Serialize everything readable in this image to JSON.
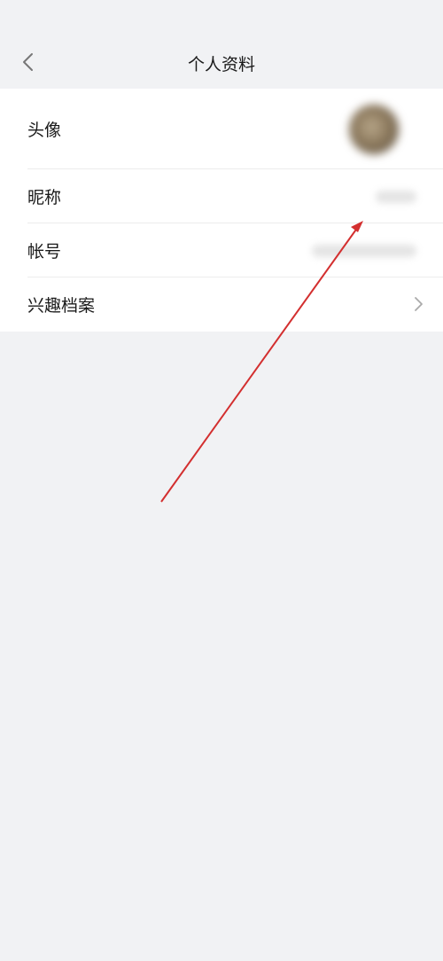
{
  "header": {
    "title": "个人资料",
    "back_icon": "chevron-left-icon"
  },
  "profile": {
    "items": [
      {
        "label": "头像",
        "value_type": "avatar"
      },
      {
        "label": "昵称",
        "value_type": "blurred-text"
      },
      {
        "label": "帐号",
        "value_type": "blurred-text"
      },
      {
        "label": "兴趣档案",
        "value_type": "chevron",
        "icon": "chevron-right-icon"
      }
    ]
  },
  "annotation": {
    "type": "arrow",
    "color": "#d32f2f"
  },
  "colors": {
    "background": "#f1f2f4",
    "row_background": "#ffffff",
    "text": "#1a1a1a"
  }
}
